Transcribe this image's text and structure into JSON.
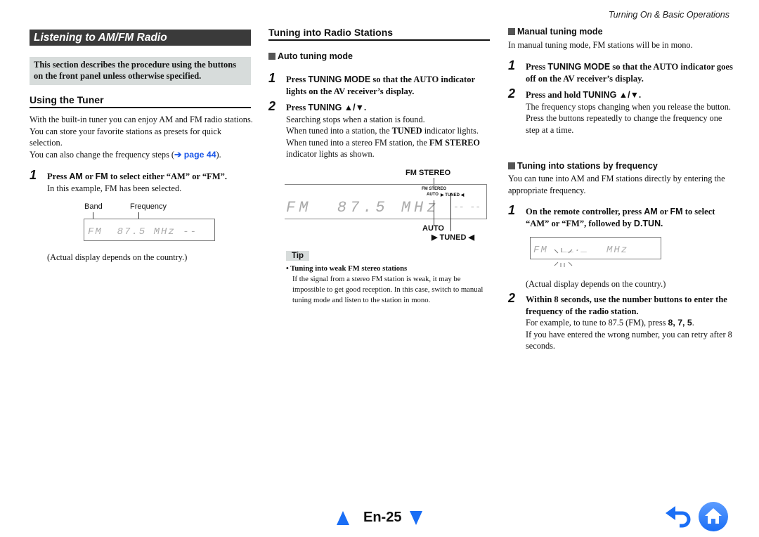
{
  "running_head": "Turning On & Basic Operations",
  "left_column": {
    "chapter_title": "Listening to AM/FM Radio",
    "note": "This section describes the procedure using the buttons on the front panel unless otherwise specified.",
    "section_title": "Using the Tuner",
    "intro_p1": "With the built-in tuner you can enjoy AM and FM radio stations. You can store your favorite stations as presets for quick selection.",
    "intro_p2_prefix": "You can also change the frequency steps (",
    "intro_p2_link": "➔ page 44",
    "intro_p2_suffix": ").",
    "step1": {
      "num": "1",
      "title_a": "Press ",
      "kw1": "AM",
      "title_b": " or ",
      "kw2": "FM",
      "title_c": " to select either “AM” or “FM”.",
      "body": "In this example, FM has been selected."
    },
    "display": {
      "label_band": "Band",
      "label_frequency": "Frequency",
      "text": "FM  87.5 MHz --"
    },
    "caption": "(Actual display depends on the country.)"
  },
  "middle_column": {
    "section_title": "Tuning into Radio Stations",
    "sub_title": "Auto tuning mode",
    "step1": {
      "num": "1",
      "title_a": "Press ",
      "kw": "TUNING MODE",
      "title_b": " so that the AUTO indicator lights on the AV receiver’s display."
    },
    "step2": {
      "num": "2",
      "title_a": "Press ",
      "kw": "TUNING ▲/▼",
      "title_b": ".",
      "body1": "Searching stops when a station is found.",
      "body2_a": "When tuned into a station, the ",
      "body2_b": "TUNED",
      "body2_c": " indicator lights. When tuned into a stereo FM station, the ",
      "body2_d": "FM STEREO",
      "body2_e": " indicator lights as shown."
    },
    "display": {
      "callout_fm_stereo": "FM STEREO",
      "ind_fm_stereo": "FM STEREO",
      "ind_auto": "AUTO",
      "ind_tuned": "▶ TUNED ◀",
      "text": "FM  87.5 MHz",
      "dashes": "-- --",
      "callout_auto": "AUTO",
      "callout_tuned": "▶ TUNED ◀"
    },
    "tip": {
      "label": "Tip",
      "bullet_title": "Tuning into weak FM stereo stations",
      "bullet_body": "If the signal from a stereo FM station is weak, it may be impossible to get good reception. In this case, switch to manual tuning mode and listen to the station in mono."
    }
  },
  "right_column": {
    "manual": {
      "sub_title": "Manual tuning mode",
      "intro": "In manual tuning mode, FM stations will be in mono.",
      "step1": {
        "num": "1",
        "title_a": "Press ",
        "kw": "TUNING MODE",
        "title_b": " so that the AUTO indicator goes off on the AV receiver’s display."
      },
      "step2": {
        "num": "2",
        "title_a": "Press and hold ",
        "kw": "TUNING ▲/▼",
        "title_b": ".",
        "body1": "The frequency stops changing when you release the button.",
        "body2": "Press the buttons repeatedly to change the frequency one step at a time."
      }
    },
    "direct": {
      "sub_title": "Tuning into stations by frequency",
      "intro": "You can tune into AM and FM stations directly by entering the appropriate frequency.",
      "step1": {
        "num": "1",
        "title_a": "On the remote controller, press ",
        "kw1": "AM",
        "title_b": " or ",
        "kw2": "FM",
        "title_c": " to select “AM” or “FM”, followed by ",
        "kw3": "D.TUN",
        "title_d": "."
      },
      "display": {
        "band": "FM",
        "digits": "__._",
        "unit": "MHz"
      },
      "caption": "(Actual display depends on the country.)",
      "step2": {
        "num": "2",
        "title": "Within 8 seconds, use the number buttons to enter the frequency of the radio station.",
        "body1_a": "For example, to tune to 87.5 (FM), press ",
        "body1_kw": "8, 7, 5",
        "body1_b": ".",
        "body2": "If you have entered the wrong number, you can retry after 8 seconds."
      }
    }
  },
  "footer": {
    "page_label": "En-25",
    "prev_icon": "triangle-up-icon",
    "next_icon": "triangle-down-icon",
    "back_icon": "return-arrow-icon",
    "home_icon": "home-icon",
    "accent_color": "#1a6ef5"
  }
}
